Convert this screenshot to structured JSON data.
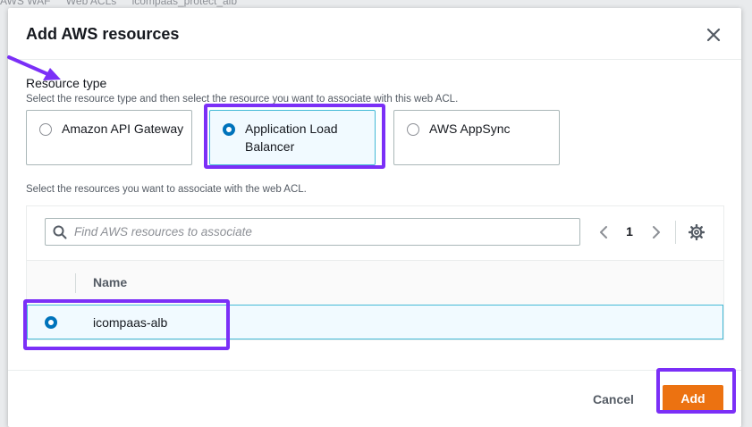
{
  "background": {
    "breadcrumb": [
      "AWS WAF",
      "Web ACLs",
      "icompaas_protect_alb"
    ]
  },
  "modal": {
    "title": "Add AWS resources",
    "close_icon": "close-icon",
    "resource_type": {
      "label": "Resource type",
      "description": "Select the resource type and then select the resource you want to associate with this web ACL.",
      "options": [
        {
          "label": "Amazon API Gateway",
          "selected": false
        },
        {
          "label": "Application Load Balancer",
          "selected": true
        },
        {
          "label": "AWS AppSync",
          "selected": false
        }
      ]
    },
    "resources": {
      "description": "Select the resources you want to associate with the web ACL.",
      "search_placeholder": "Find AWS resources to associate",
      "search_value": "",
      "pagination": {
        "page": "1",
        "prev_icon": "chevron-left-icon",
        "next_icon": "chevron-right-icon"
      },
      "settings_icon": "gear-icon",
      "columns": [
        "Name"
      ],
      "rows": [
        {
          "name": "icompaas-alb",
          "selected": true
        }
      ]
    },
    "footer": {
      "cancel_label": "Cancel",
      "add_label": "Add"
    }
  },
  "colors": {
    "primary_button": "#ec7211",
    "selected_border": "#44b9d6",
    "selected_bg": "#f1faff",
    "radio_selected": "#0073bb",
    "annotation": "#7b2ff7"
  }
}
